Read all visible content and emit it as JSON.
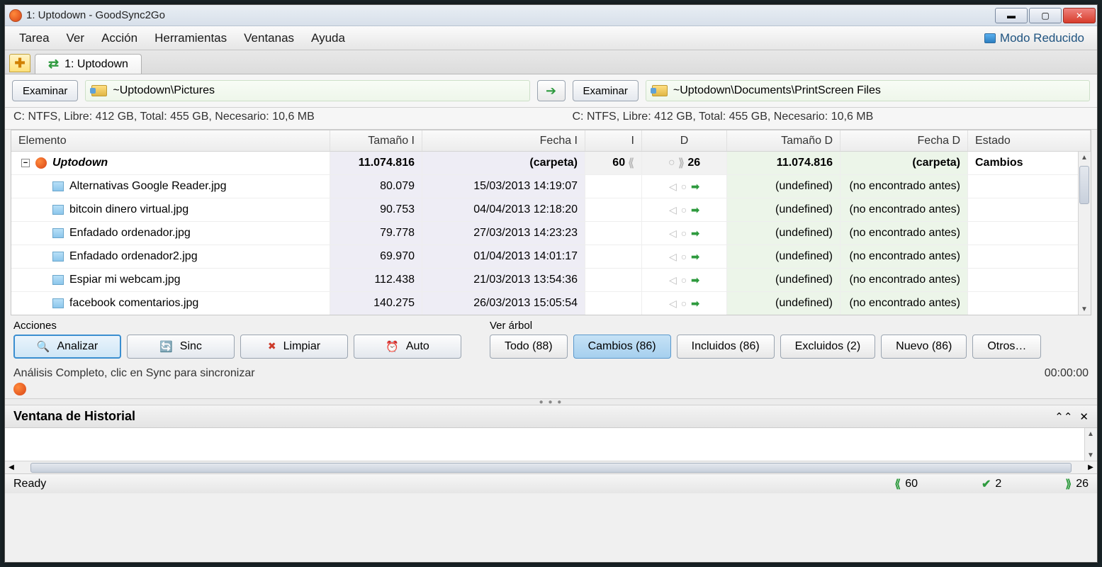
{
  "window": {
    "title": "1: Uptodown - GoodSync2Go"
  },
  "menu": [
    "Tarea",
    "Ver",
    "Acción",
    "Herramientas",
    "Ventanas",
    "Ayuda"
  ],
  "mode_button": "Modo Reducido",
  "tab": {
    "label": "1: Uptodown"
  },
  "browse_btn": "Examinar",
  "left_path": "~Uptodown\\Pictures",
  "right_path": "~Uptodown\\Documents\\PrintScreen Files",
  "left_stats": "C: NTFS, Libre: 412 GB, Total: 455 GB, Necesario: 10,6 MB",
  "right_stats": "C: NTFS, Libre: 412 GB, Total: 455 GB, Necesario: 10,6 MB",
  "columns": {
    "el": "Elemento",
    "si": "Tamaño I",
    "fi": "Fecha I",
    "i": "I",
    "d": "D",
    "sd": "Tamaño D",
    "fd": "Fecha D",
    "es": "Estado"
  },
  "root": {
    "name": "Uptodown",
    "si": "11.074.816",
    "fi": "(carpeta)",
    "i": "60",
    "d": "26",
    "sd": "11.074.816",
    "fd": "(carpeta)",
    "es": "Cambios"
  },
  "rows": [
    {
      "name": "Alternativas Google Reader.jpg",
      "si": "80.079",
      "fi": "15/03/2013 14:19:07",
      "sd": "(undefined)",
      "fd": "(no encontrado antes)"
    },
    {
      "name": "bitcoin dinero virtual.jpg",
      "si": "90.753",
      "fi": "04/04/2013 12:18:20",
      "sd": "(undefined)",
      "fd": "(no encontrado antes)"
    },
    {
      "name": "Enfadado ordenador.jpg",
      "si": "79.778",
      "fi": "27/03/2013 14:23:23",
      "sd": "(undefined)",
      "fd": "(no encontrado antes)"
    },
    {
      "name": "Enfadado ordenador2.jpg",
      "si": "69.970",
      "fi": "01/04/2013 14:01:17",
      "sd": "(undefined)",
      "fd": "(no encontrado antes)"
    },
    {
      "name": "Espiar mi webcam.jpg",
      "si": "112.438",
      "fi": "21/03/2013 13:54:36",
      "sd": "(undefined)",
      "fd": "(no encontrado antes)"
    },
    {
      "name": "facebook comentarios.jpg",
      "si": "140.275",
      "fi": "26/03/2013 15:05:54",
      "sd": "(undefined)",
      "fd": "(no encontrado antes)"
    }
  ],
  "actions_label": "Acciones",
  "tree_label": "Ver árbol",
  "action_buttons": {
    "analizar": "Analizar",
    "sinc": "Sinc",
    "limpiar": "Limpiar",
    "auto": "Auto"
  },
  "tree_buttons": {
    "todo": "Todo (88)",
    "cambios": "Cambios (86)",
    "incluidos": "Incluidos (86)",
    "excluidos": "Excluidos (2)",
    "nuevo": "Nuevo (86)",
    "otros": "Otros…"
  },
  "status_msg": "Análisis Completo, clic en Sync para sincronizar",
  "status_time": "00:00:00",
  "history_title": "Ventana de Historial",
  "footer": {
    "ready": "Ready",
    "left": "60",
    "ok": "2",
    "right": "26"
  }
}
